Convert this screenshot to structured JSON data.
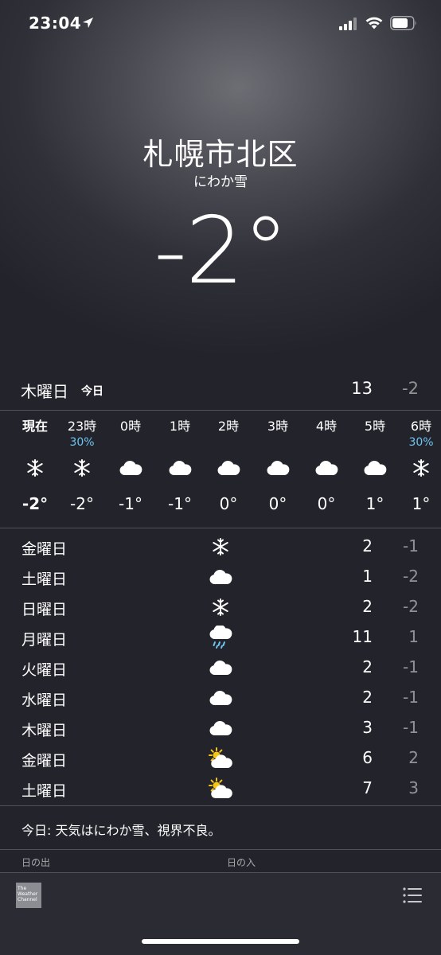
{
  "status": {
    "time": "23:04"
  },
  "header": {
    "city": "札幌市北区",
    "condition": "にわか雪",
    "temperature": "-2°"
  },
  "today": {
    "day": "木曜日",
    "tag": "今日",
    "high": "13",
    "low": "-2"
  },
  "hourly": [
    {
      "label": "現在",
      "pop": "",
      "icon": "snow",
      "temp": "-2°"
    },
    {
      "label": "23時",
      "pop": "30%",
      "icon": "snow",
      "temp": "-2°"
    },
    {
      "label": "0時",
      "pop": "",
      "icon": "cloud",
      "temp": "-1°"
    },
    {
      "label": "1時",
      "pop": "",
      "icon": "cloud",
      "temp": "-1°"
    },
    {
      "label": "2時",
      "pop": "",
      "icon": "cloud",
      "temp": "0°"
    },
    {
      "label": "3時",
      "pop": "",
      "icon": "cloud",
      "temp": "0°"
    },
    {
      "label": "4時",
      "pop": "",
      "icon": "cloud",
      "temp": "0°"
    },
    {
      "label": "5時",
      "pop": "",
      "icon": "cloud",
      "temp": "1°"
    },
    {
      "label": "6時",
      "pop": "30%",
      "icon": "snow",
      "temp": "1°"
    }
  ],
  "daily": [
    {
      "day": "金曜日",
      "icon": "snow",
      "high": "2",
      "low": "-1"
    },
    {
      "day": "土曜日",
      "icon": "cloud",
      "high": "1",
      "low": "-2"
    },
    {
      "day": "日曜日",
      "icon": "snow",
      "high": "2",
      "low": "-2"
    },
    {
      "day": "月曜日",
      "icon": "rain",
      "high": "11",
      "low": "1"
    },
    {
      "day": "火曜日",
      "icon": "cloud",
      "high": "2",
      "low": "-1"
    },
    {
      "day": "水曜日",
      "icon": "cloud",
      "high": "2",
      "low": "-1"
    },
    {
      "day": "木曜日",
      "icon": "cloud",
      "high": "3",
      "low": "-1"
    },
    {
      "day": "金曜日",
      "icon": "partly-sunny",
      "high": "6",
      "low": "2"
    },
    {
      "day": "土曜日",
      "icon": "partly-sunny",
      "high": "7",
      "low": "3"
    }
  ],
  "summary": "今日: 天気はにわか雪、視界不良。",
  "details": {
    "sunrise_label": "日の出",
    "sunset_label": "日の入"
  },
  "footer": {
    "logo_text": "The Weather Channel",
    "list_icon": "list-icon"
  },
  "colors": {
    "pop": "#6fc4ef",
    "sun": "#f5c518"
  }
}
